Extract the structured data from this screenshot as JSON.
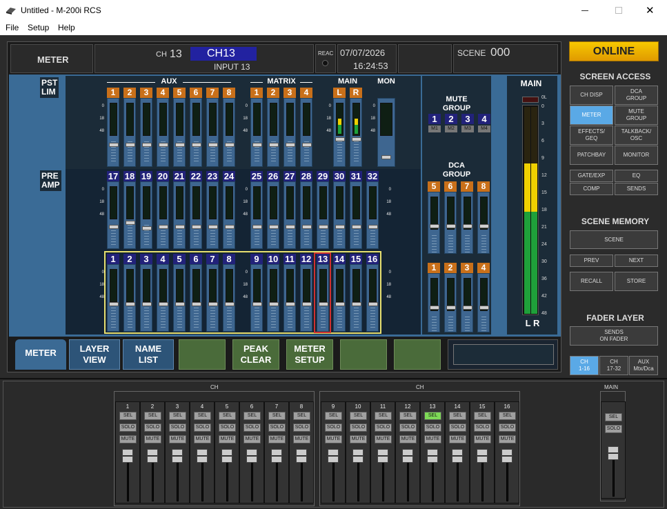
{
  "window": {
    "title": "Untitled - M-200i RCS",
    "min_icon": "minimize-icon",
    "max_icon": "maximize-icon",
    "close_glyph": "✕"
  },
  "menu": [
    "File",
    "Setup",
    "Help"
  ],
  "header": {
    "view_label": "METER",
    "ch_prefix": "CH",
    "ch_number": "13",
    "ch_name": "CH13",
    "input_label": "INPUT 13",
    "reac_label": "REAC",
    "date": "07/07/2026",
    "time": "16:24:53",
    "scene_label": "SCENE",
    "scene_number": "000"
  },
  "labels": {
    "pst_lim": "PST\nLIM",
    "pre_amp": "PRE\nAMP",
    "aux": "AUX",
    "matrix": "MATRIX",
    "main": "MAIN",
    "mon": "MON",
    "mute_group_1": "MUTE",
    "mute_group_2": "GROUP",
    "dca_group_1": "DCA",
    "dca_group_2": "GROUP",
    "main_meter": "MAIN",
    "lr": "L R"
  },
  "aux_nums": [
    "1",
    "2",
    "3",
    "4",
    "5",
    "6",
    "7",
    "8"
  ],
  "matrix_nums": [
    "1",
    "2",
    "3",
    "4"
  ],
  "main_nums": [
    "L",
    "R"
  ],
  "row2_nums": [
    "17",
    "18",
    "19",
    "20",
    "21",
    "22",
    "23",
    "24",
    "25",
    "26",
    "27",
    "28",
    "29",
    "30",
    "31",
    "32"
  ],
  "row3_nums": [
    "1",
    "2",
    "3",
    "4",
    "5",
    "6",
    "7",
    "8",
    "9",
    "10",
    "11",
    "12",
    "13",
    "14",
    "15",
    "16"
  ],
  "mute_nums": [
    "1",
    "2",
    "3",
    "4"
  ],
  "mute_sub": [
    "M1",
    "M2",
    "M3",
    "M4"
  ],
  "dca_top": [
    "5",
    "6",
    "7",
    "8"
  ],
  "dca_bottom": [
    "1",
    "2",
    "3",
    "4"
  ],
  "scale_marks": [
    "0",
    "18",
    "48"
  ],
  "main_scale": [
    "0L",
    "0",
    "3",
    "6",
    "9",
    "12",
    "15",
    "18",
    "21",
    "24",
    "30",
    "36",
    "42",
    "48"
  ],
  "tabs": {
    "meter": "METER",
    "layer_view": "LAYER\nVIEW",
    "name_list": "NAME\nLIST",
    "peak_clear": "PEAK\nCLEAR",
    "meter_setup": "METER\nSETUP"
  },
  "right_panel": {
    "online": "ONLINE",
    "screen_access": "SCREEN ACCESS",
    "ch_disp": "CH DISP",
    "dca_group": "DCA\nGROUP",
    "meter": "METER",
    "mute_group": "MUTE\nGROUP",
    "effects_geq": "EFFECTS/\nGEQ",
    "talkback_osc": "TALKBACK/\nOSC",
    "patchbay": "PATCHBAY",
    "monitor": "MONITOR",
    "gate_exp": "GATE/EXP",
    "eq": "EQ",
    "comp": "COMP",
    "sends": "SENDS",
    "scene_memory": "SCENE MEMORY",
    "scene": "SCENE",
    "prev": "PREV",
    "next": "NEXT",
    "recall": "RECALL",
    "store": "STORE",
    "fader_layer": "FADER LAYER",
    "sends_on_fader": "SENDS\nON FADER",
    "ch_1_16": "CH\n1-16",
    "ch_17_32": "CH\n17-32",
    "aux_mtx_dca": "AUX\nMtx/Dca"
  },
  "bottom": {
    "ch_label_left": "CH",
    "ch_label_right": "CH",
    "main_label": "MAIN",
    "strip_nums": [
      "1",
      "2",
      "3",
      "4",
      "5",
      "6",
      "7",
      "8",
      "9",
      "10",
      "11",
      "12",
      "13",
      "14",
      "15",
      "16"
    ],
    "sel": "SEL",
    "solo": "SOLO",
    "mute": "MUTE"
  },
  "colors": {
    "online": "#f0b000",
    "selected_sel": "#7ed957",
    "accent_blue": "#5aa9e6",
    "highlight_yellow": "#e8e070",
    "selected_red": "#d03030"
  }
}
